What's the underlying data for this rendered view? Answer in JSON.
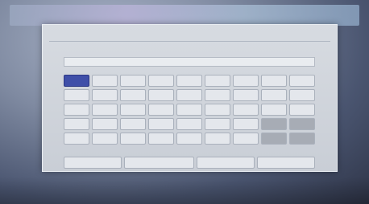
{
  "panel": {
    "title": "",
    "field_label": "",
    "input_value": ""
  },
  "keyboard": {
    "rows": [
      [
        "",
        "",
        "",
        "",
        "",
        "",
        "",
        "",
        ""
      ],
      [
        "",
        "",
        "",
        "",
        "",
        "",
        "",
        "",
        ""
      ],
      [
        "",
        "",
        "",
        "",
        "",
        "",
        "",
        "",
        ""
      ],
      [
        "",
        "",
        "",
        "",
        "",
        "",
        "",
        "",
        ""
      ],
      [
        "",
        "",
        "",
        "",
        "",
        "",
        "",
        "",
        ""
      ]
    ],
    "bottom": [
      "",
      "",
      "",
      ""
    ]
  },
  "footer": {
    "buttons": [
      "",
      "",
      ""
    ]
  }
}
